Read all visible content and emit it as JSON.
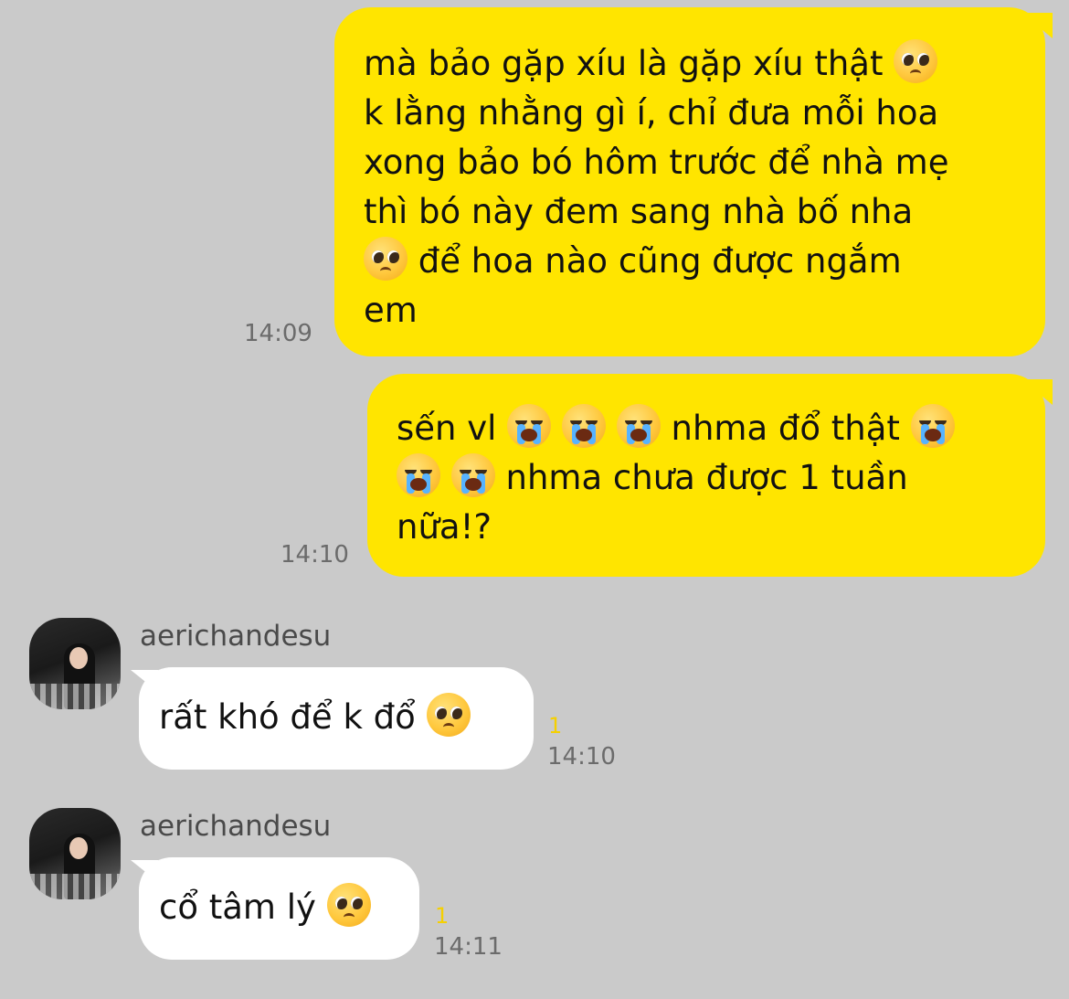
{
  "messages": [
    {
      "direction": "out",
      "time": "14:09",
      "lines": [
        "mà bảo gặp xíu là gặp xíu thật",
        "k lằng nhằng gì í, chỉ đưa mỗi hoa",
        "xong bảo bó hôm trước để nhà mẹ",
        "thì bó này đem sang nhà bố nha",
        "để hoa nào cũng được ngắm",
        "em"
      ],
      "emojis": [
        "pleading-face-emoji",
        "pleading-face-emoji"
      ]
    },
    {
      "direction": "out",
      "time": "14:10",
      "lines": [
        "sến vl",
        "nhma đổ thật",
        "nhma chưa được 1 tuần",
        "nữa!?"
      ],
      "emojis": [
        "loudly-crying-face-emoji"
      ]
    },
    {
      "direction": "in",
      "sender": "aerichandesu",
      "text": "rất khó để k đổ",
      "unread": "1",
      "time": "14:10",
      "emojis": [
        "pleading-face-emoji"
      ]
    },
    {
      "direction": "in",
      "sender": "aerichandesu",
      "text": "cổ tâm lý",
      "unread": "1",
      "time": "14:11",
      "emojis": [
        "pleading-face-emoji"
      ]
    }
  ],
  "colors": {
    "background": "#cacaca",
    "outgoing_bubble": "#ffe500",
    "incoming_bubble": "#ffffff",
    "unread_count": "#f5d000"
  }
}
